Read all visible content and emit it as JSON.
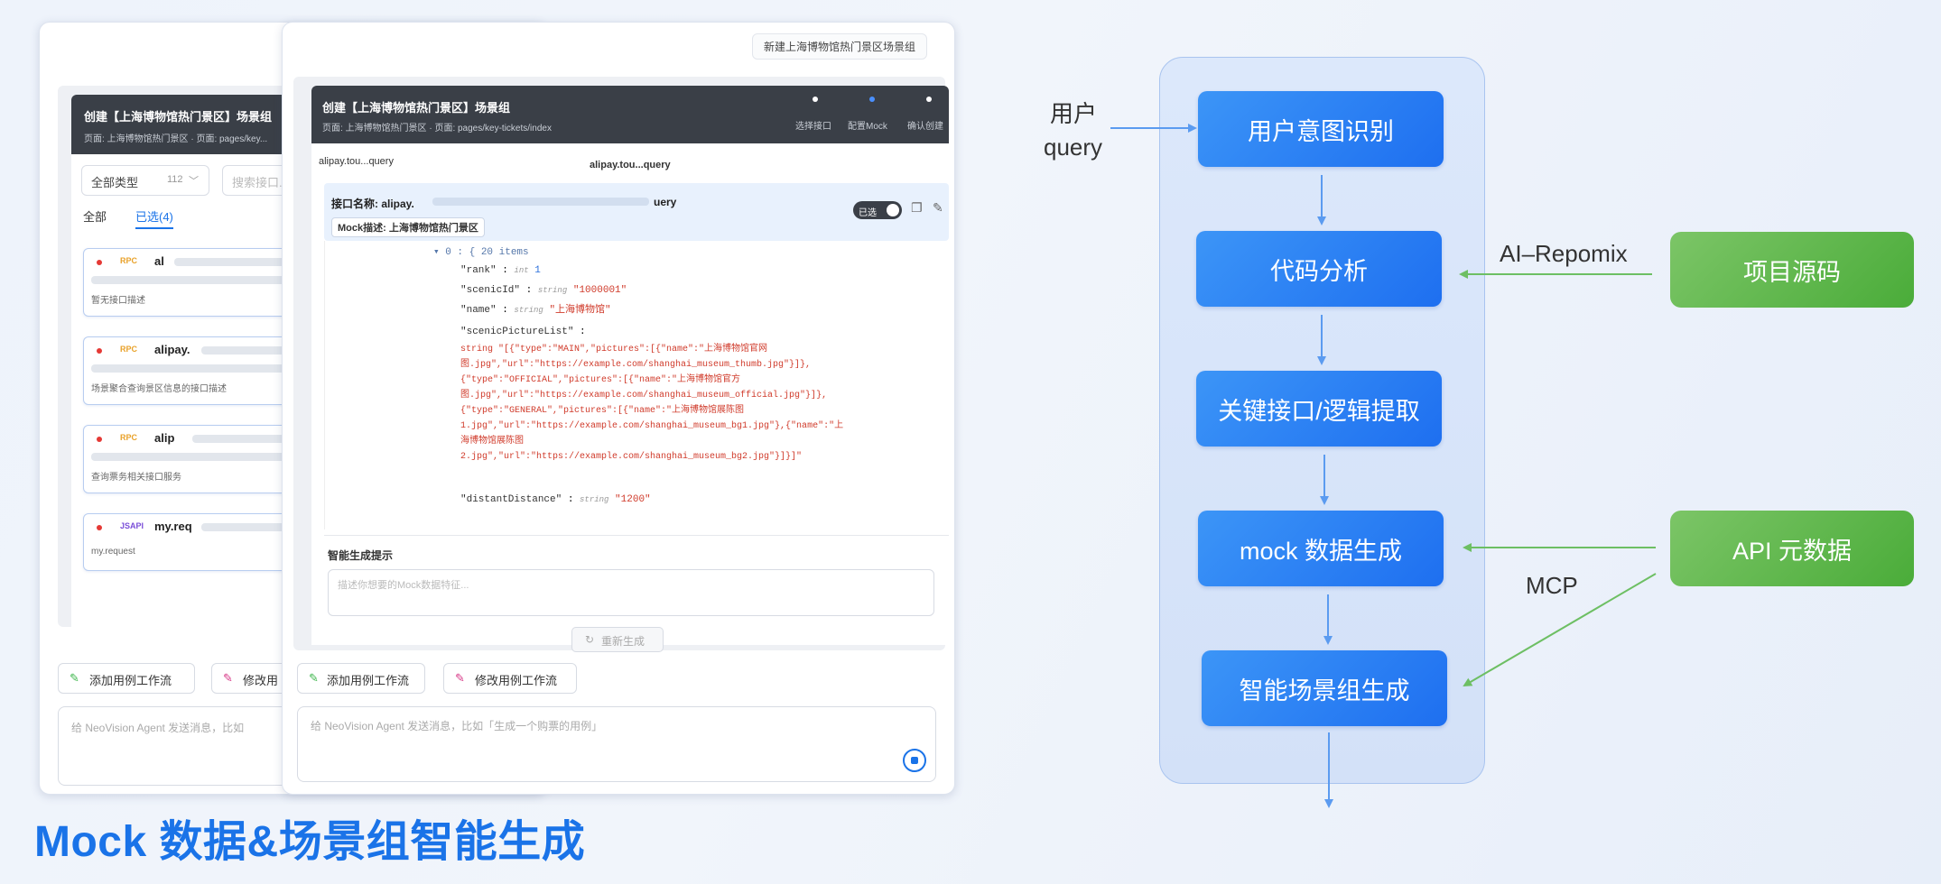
{
  "title": "Mock 数据&场景组智能生成",
  "screenshot": {
    "back": {
      "header_title": "创建【上海博物馆热门景区】场景组",
      "header_sub": "页面: 上海博物馆热门景区 · 页面: pages/key...",
      "filter_type": "全部类型",
      "filter_count": "112",
      "search_placeholder": "搜索接口...",
      "tabs": [
        "全部",
        "已选(4)"
      ],
      "items": [
        {
          "method": "RPC",
          "name": "al",
          "desc": "暂无接口描述"
        },
        {
          "method": "RPC",
          "name": "alipay.",
          "desc": "场景聚合查询景区信息的接口描述"
        },
        {
          "method": "RPC",
          "name": "alip",
          "desc": "查询票务相关接口服务"
        },
        {
          "method": "JSAPI",
          "name": "my.req",
          "desc": "my.request"
        }
      ],
      "btn_add": "添加用例工作流",
      "btn_edit": "修改用"
    },
    "front": {
      "top_right": "新建上海博物馆热门景区场景组",
      "header_title": "创建【上海博物馆热门景区】场景组",
      "header_sub": "页面: 上海博物馆热门景区 · 页面: pages/key-tickets/index",
      "steps": [
        "选择接口",
        "配置Mock",
        "确认创建"
      ],
      "api_tabs": [
        "alipay.tou...query",
        "alipay.tou...query"
      ],
      "api_name_label": "接口名称: alipay.",
      "api_name_suffix": "uery",
      "mock_desc_label": "Mock描述: 上海博物馆热门景区",
      "toggle_label": "已选",
      "code": {
        "root": "▾ 0 : { 20 items",
        "rank_key": "\"rank\"",
        "rank_type": "int",
        "rank_val": "1",
        "scenicId_key": "\"scenicId\"",
        "scenicId_val": "\"1000001\"",
        "name_key": "\"name\"",
        "name_val": "\"上海博物馆\"",
        "list_key": "\"scenicPictureList\"",
        "list_lines": [
          "string \"[{\"type\":\"MAIN\",\"pictures\":[{\"name\":\"上海博物馆官网",
          "图.jpg\",\"url\":\"https://example.com/shanghai_museum_thumb.jpg\"}]},",
          "{\"type\":\"OFFICIAL\",\"pictures\":[{\"name\":\"上海博物馆官方",
          "图.jpg\",\"url\":\"https://example.com/shanghai_museum_official.jpg\"}]},",
          "{\"type\":\"GENERAL\",\"pictures\":[{\"name\":\"上海博物馆展陈图",
          "1.jpg\",\"url\":\"https://example.com/shanghai_museum_bg1.jpg\"},{\"name\":\"上",
          "海博物馆展陈图",
          "2.jpg\",\"url\":\"https://example.com/shanghai_museum_bg2.jpg\"}]}]\""
        ],
        "dist_key": "\"distantDistance\"",
        "dist_val": "\"1200\""
      },
      "smart_label": "智能生成提示",
      "smart_placeholder": "描述你想要的Mock数据特征...",
      "regenerate": "重新生成",
      "btn_add": "添加用例工作流",
      "btn_edit": "修改用例工作流",
      "chat_placeholder": "给 NeoVision Agent 发送消息，比如「生成一个购票的用例」",
      "back_chat_placeholder": "给 NeoVision Agent 发送消息，比如"
    }
  },
  "diagram": {
    "nodes": [
      "用户意图识别",
      "代码分析",
      "关键接口/逻辑提取",
      "mock 数据生成",
      "智能场景组生成"
    ],
    "sources": [
      "项目源码",
      "API 元数据"
    ],
    "labels": {
      "user_query_line1": "用户",
      "user_query_line2": "query",
      "repomix": "AI–Repomix",
      "mcp": "MCP"
    },
    "colors": {
      "blue": "#1e6ff0",
      "green": "#4aac39",
      "arrow_blue": "#5b9bf0",
      "arrow_green": "#6dbf63"
    }
  }
}
